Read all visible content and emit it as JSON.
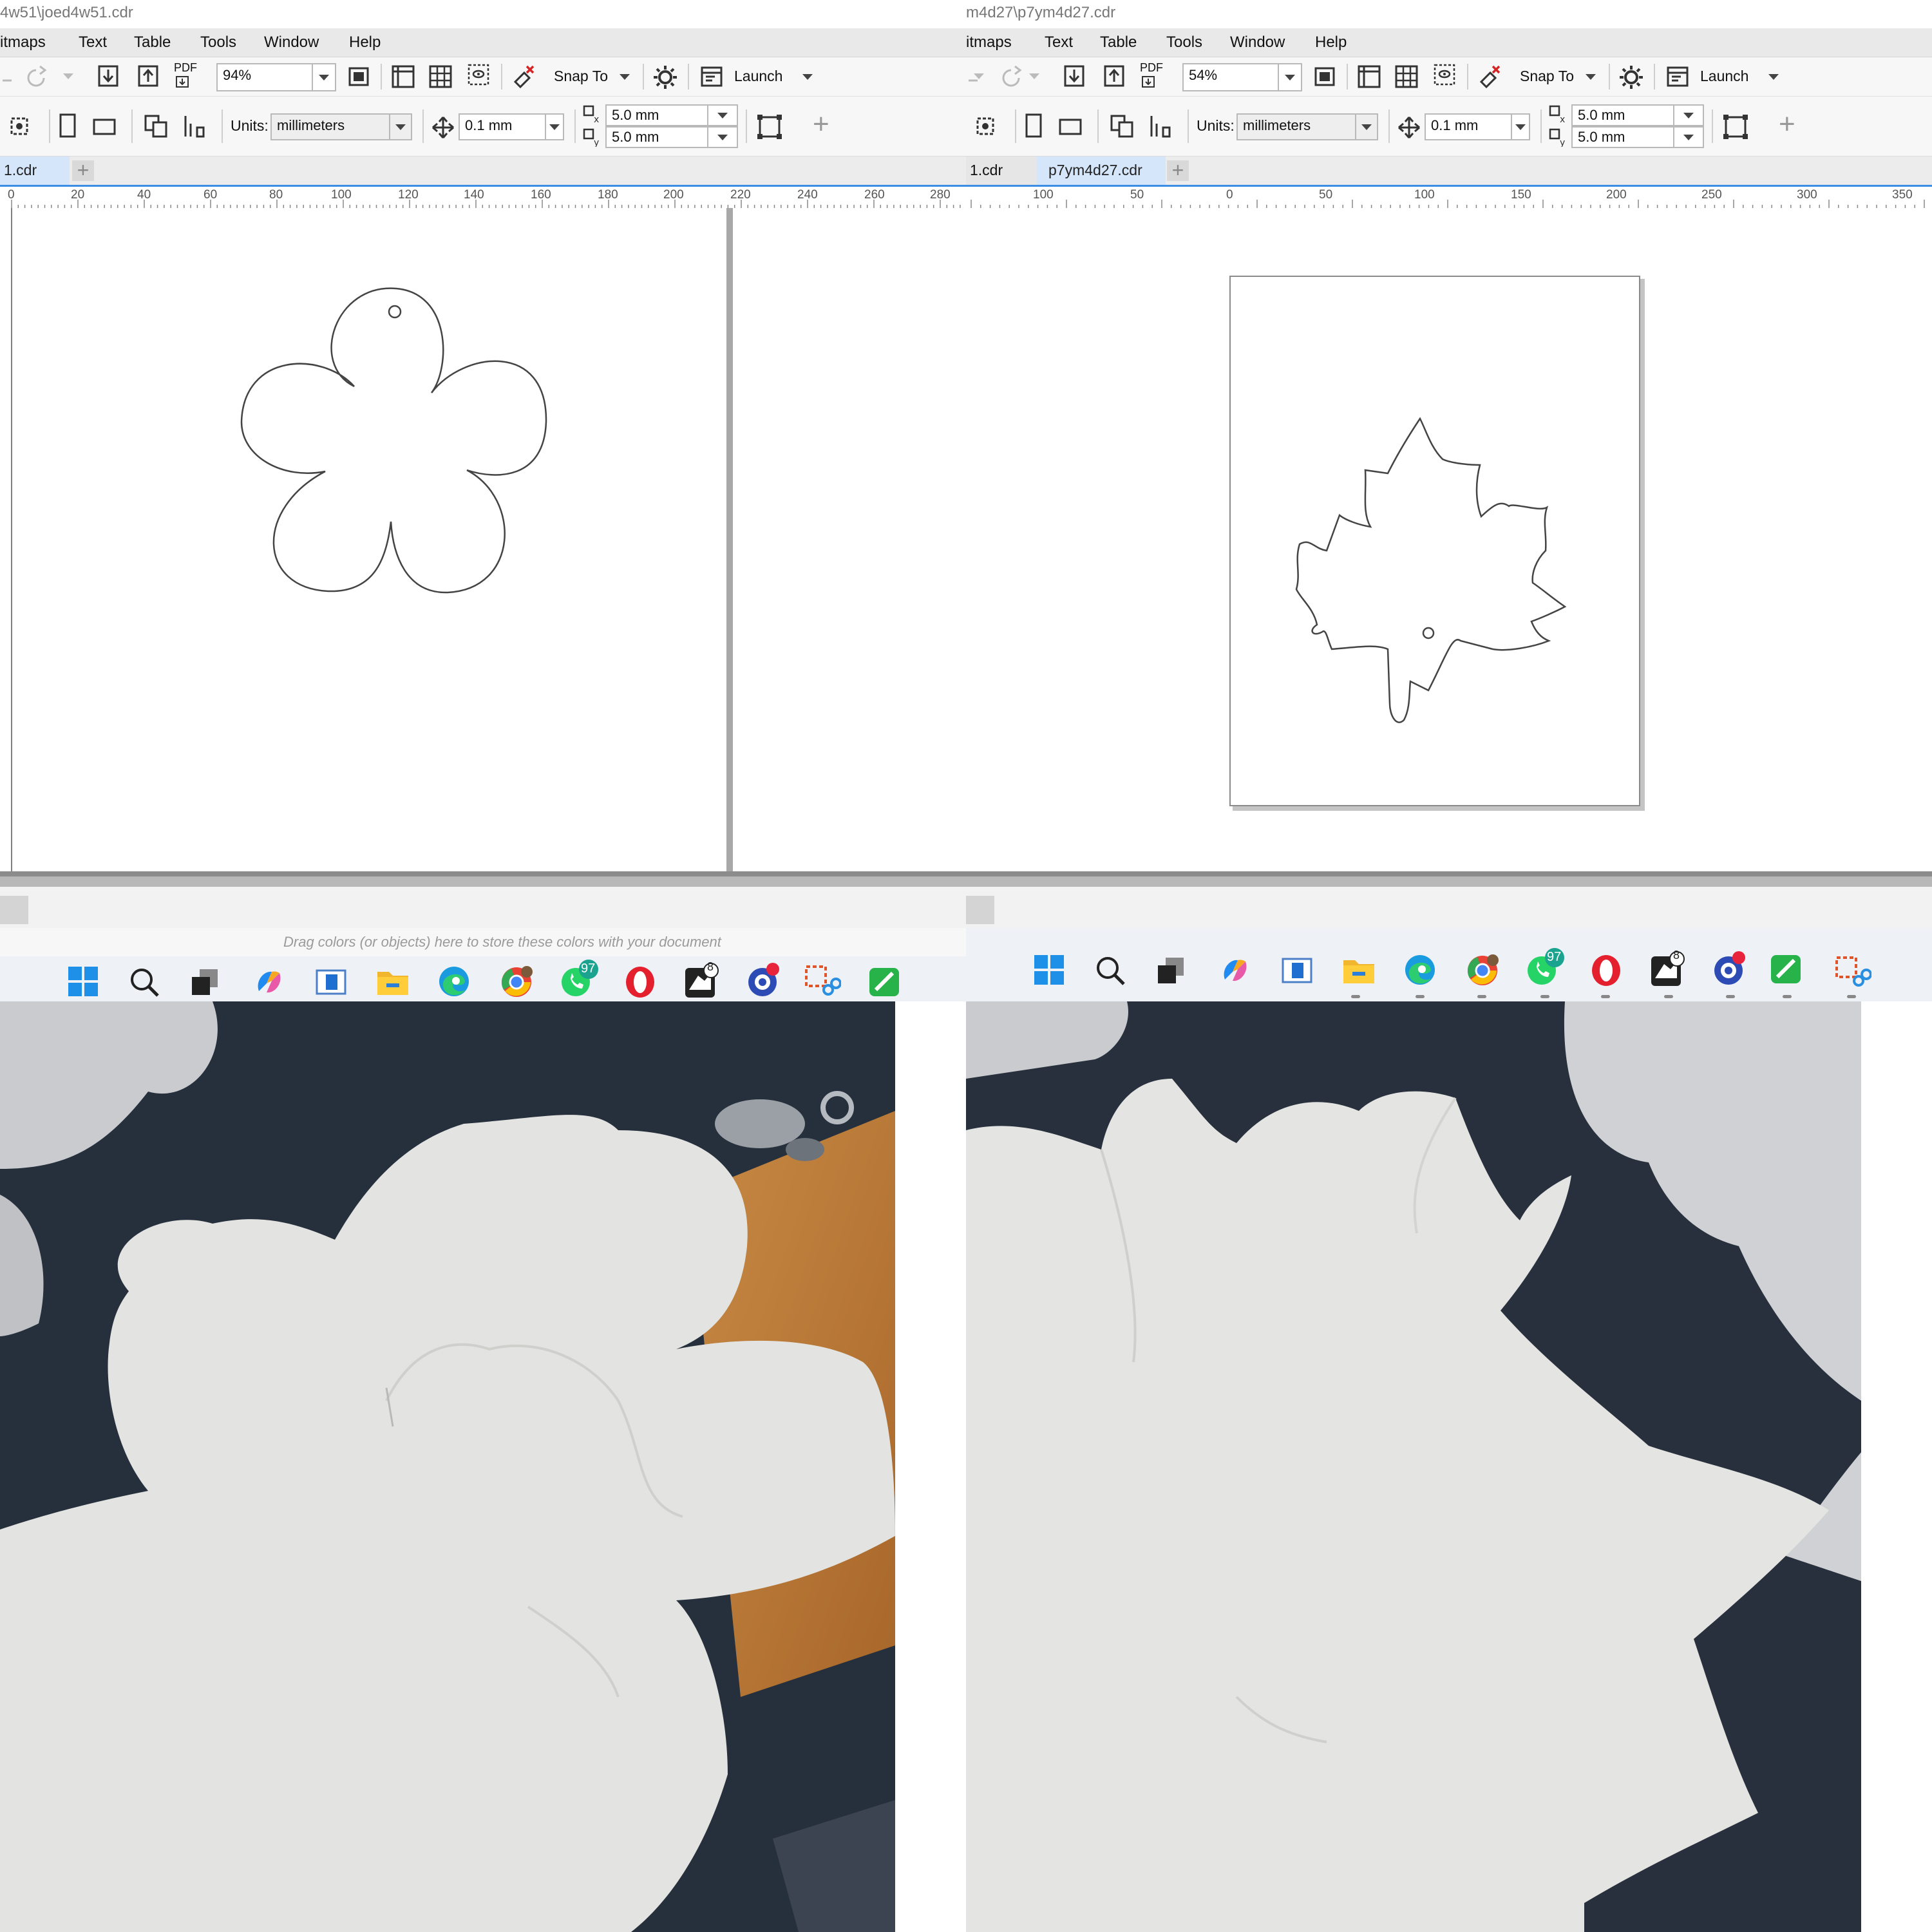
{
  "left_window": {
    "title": "4w51\\joed4w51.cdr",
    "menu": [
      "itmaps",
      "Text",
      "Table",
      "Tools",
      "Window",
      "Help"
    ],
    "zoom": "94%",
    "snap_label": "Snap To",
    "launch_label": "Launch",
    "pdf_label": "PDF",
    "units_label": "Units:",
    "units_value": "millimeters",
    "nudge_value": "0.1 mm",
    "dup_x": "5.0 mm",
    "dup_y": "5.0 mm",
    "tab_active": "1.cdr",
    "ruler_ticks": [
      "0",
      "20",
      "40",
      "60",
      "80",
      "100",
      "120",
      "140",
      "160",
      "180",
      "200",
      "220",
      "240",
      "260",
      "280"
    ],
    "shape": "flower-outline",
    "doc_palette_hint": "Drag colors (or objects) here to store these colors with your document",
    "badge_whatsapp": "97",
    "badge_rhino": "8"
  },
  "right_window": {
    "title": "m4d27\\p7ym4d27.cdr",
    "menu": [
      "itmaps",
      "Text",
      "Table",
      "Tools",
      "Window",
      "Help"
    ],
    "zoom": "54%",
    "snap_label": "Snap To",
    "launch_label": "Launch",
    "pdf_label": "PDF",
    "units_label": "Units:",
    "units_value": "millimeters",
    "nudge_value": "0.1 mm",
    "dup_x": "5.0 mm",
    "dup_y": "5.0 mm",
    "tab_inactive": "1.cdr",
    "tab_active": "p7ym4d27.cdr",
    "ruler_ticks": [
      "100",
      "50",
      "0",
      "50",
      "100",
      "150",
      "200",
      "250",
      "300",
      "350"
    ],
    "shape": "maple-leaf-outline",
    "badge_whatsapp": "97",
    "badge_rhino": "8"
  },
  "photos": {
    "left": "paper-flower-cutout-photo",
    "right": "paper-maple-leaf-cutout-photo"
  },
  "colors": {
    "menubar": "#e9e9e9",
    "toolbar": "#f7f7f7",
    "tab_active": "#d5e6fb",
    "ruler_line": "#3a8ee6",
    "desk_dark": "#27303c",
    "paper": "#e4e4e2"
  }
}
